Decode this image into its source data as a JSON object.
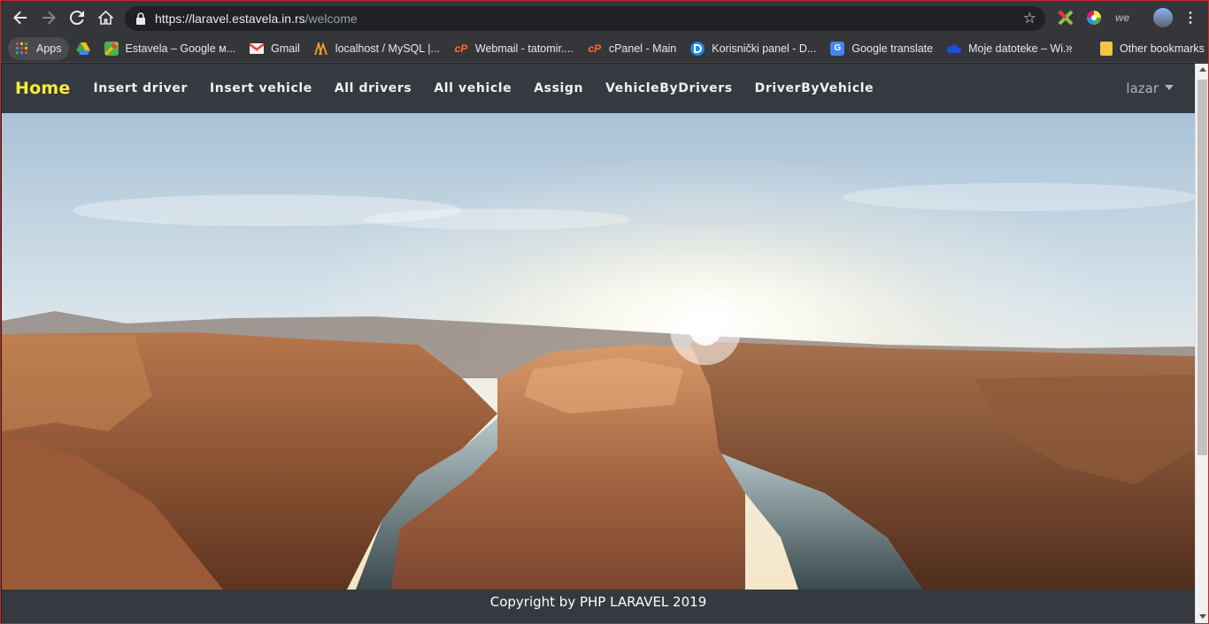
{
  "browser": {
    "url_host": "https://laravel.estavela.in.rs",
    "url_path": "/welcome"
  },
  "bookmarks": {
    "items": [
      {
        "label": "Apps",
        "icon": "apps-grid-icon"
      },
      {
        "label": "",
        "icon": "google-drive-icon"
      },
      {
        "label": "Estavela – Google м...",
        "icon": "google-maps-icon"
      },
      {
        "label": "Gmail",
        "icon": "gmail-icon"
      },
      {
        "label": "localhost / MySQL |...",
        "icon": "phpmyadmin-icon"
      },
      {
        "label": "Webmail - tatomir....",
        "icon": "cpanel-icon"
      },
      {
        "label": "cPanel - Main",
        "icon": "cpanel-icon"
      },
      {
        "label": "Korisnički panel - D...",
        "icon": "panel-icon"
      },
      {
        "label": "Google translate",
        "icon": "google-translate-icon"
      },
      {
        "label": "Moje datoteke – Wi...",
        "icon": "cloud-icon"
      }
    ],
    "more": "»",
    "other": "Other bookmarks"
  },
  "site": {
    "brand": "Home",
    "nav": [
      "Insert driver",
      "Insert vehicle",
      "All drivers",
      "All vehicle",
      "Assign",
      "VehicleByDrivers",
      "DriverByVehicle"
    ],
    "user": "lazar",
    "footer": "Copyright by PHP LARAVEL 2019"
  },
  "colors": {
    "chrome_dark": "#35363a",
    "navbar": "#343a40",
    "brand": "#ffeb3b"
  }
}
